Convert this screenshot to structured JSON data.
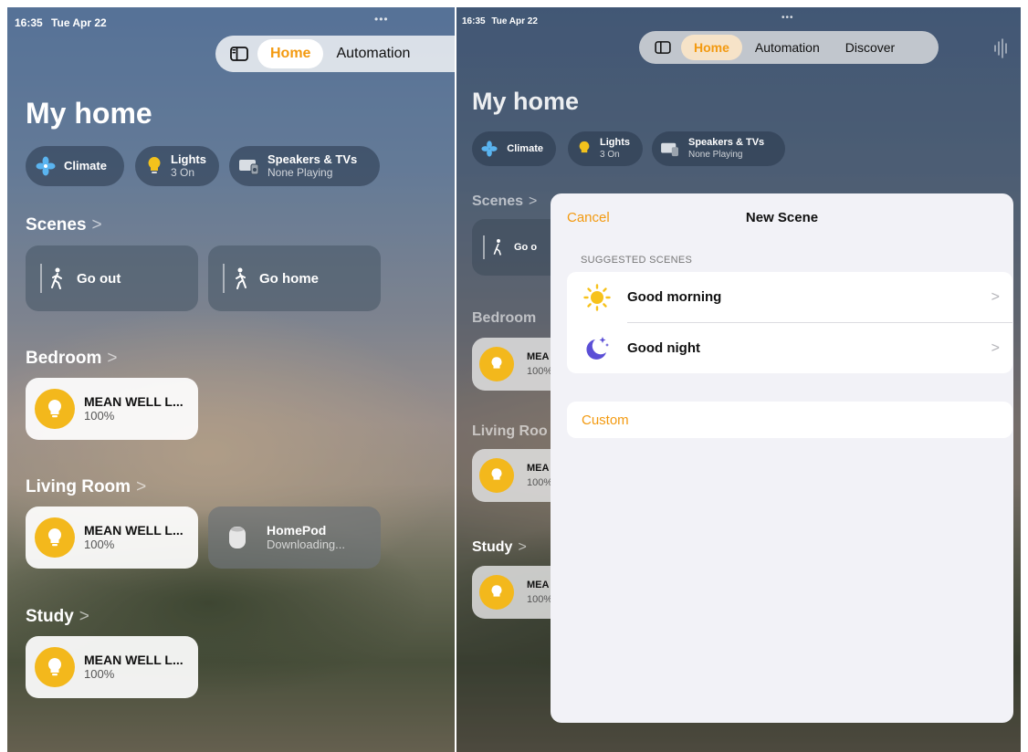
{
  "status": {
    "time": "16:35",
    "date": "Tue Apr 22"
  },
  "left": {
    "tabs": [
      "Home",
      "Automation"
    ],
    "title": "My home",
    "chips": [
      {
        "label": "Climate",
        "icon": "fan-icon"
      },
      {
        "label": "Lights",
        "sub": "3 On",
        "icon": "lightbulb-icon"
      },
      {
        "label": "Speakers & TVs",
        "sub": "None Playing",
        "icon": "speakers-tv-icon"
      }
    ],
    "scenes_label": "Scenes",
    "scenes": [
      "Go out",
      "Go home"
    ],
    "rooms": [
      {
        "name": "Bedroom",
        "accessories": [
          {
            "name": "MEAN WELL L...",
            "value": "100%"
          }
        ]
      },
      {
        "name": "Living Room",
        "accessories": [
          {
            "name": "MEAN WELL L...",
            "value": "100%"
          },
          {
            "name": "HomePod",
            "value": "Downloading..."
          }
        ]
      },
      {
        "name": "Study",
        "accessories": [
          {
            "name": "MEAN WELL L...",
            "value": "100%"
          }
        ]
      }
    ]
  },
  "right": {
    "tabs": [
      "Home",
      "Automation",
      "Discover"
    ],
    "title": "My home",
    "chips": [
      {
        "label": "Climate"
      },
      {
        "label": "Lights",
        "sub": "3 On"
      },
      {
        "label": "Speakers & TVs",
        "sub": "None Playing"
      }
    ],
    "bg_labels": [
      "Scenes",
      "Go o",
      "Bedroom",
      "MEA",
      "100%",
      "Living Roo",
      "MEA",
      "100%",
      "Study",
      "MEA",
      "100%"
    ],
    "sheet": {
      "cancel": "Cancel",
      "title": "New Scene",
      "section_header": "SUGGESTED SCENES",
      "suggested": [
        {
          "label": "Good morning",
          "icon": "sun-icon"
        },
        {
          "label": "Good night",
          "icon": "moon-stars-icon"
        }
      ],
      "custom": "Custom"
    }
  },
  "colors": {
    "accent": "#f39a10",
    "bulb": "#f3b81c",
    "night_icon": "#5b4fd6"
  }
}
